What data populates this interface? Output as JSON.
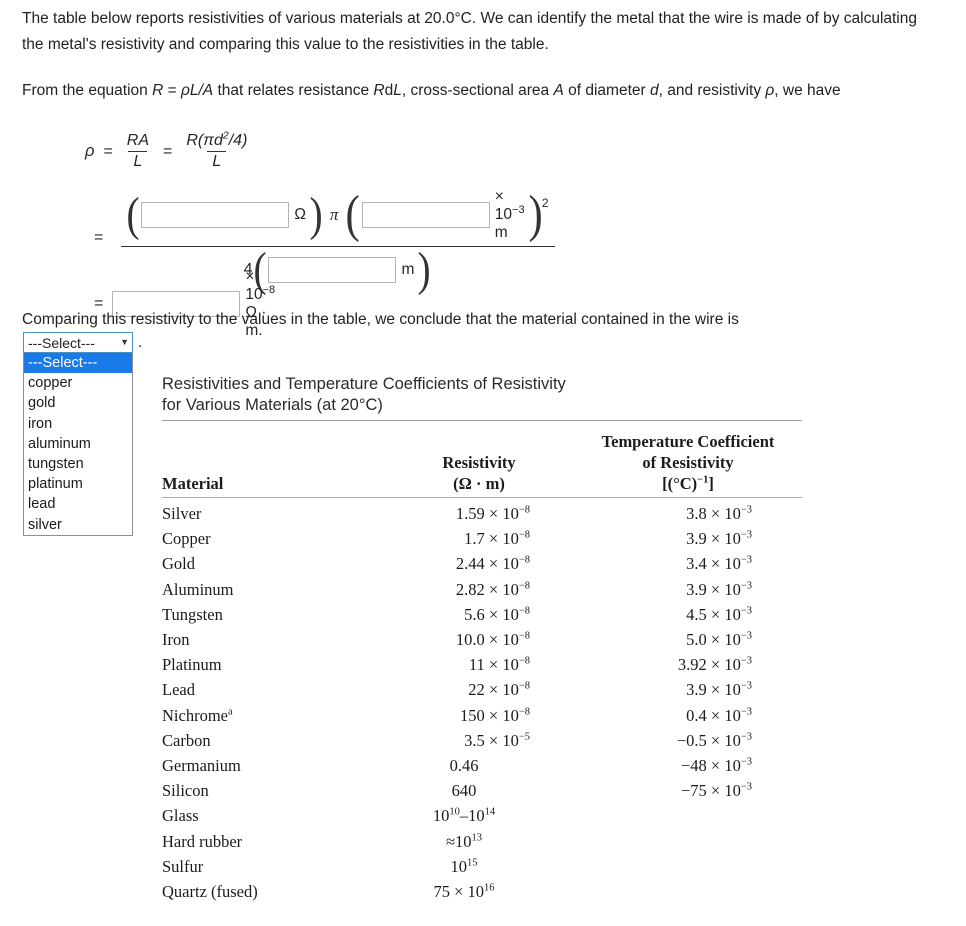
{
  "paragraphs": {
    "p1": "The table below reports resistivities of various materials at 20.0°C. We can identify the metal that the wire is made of by calculating the metal's resistivity and comparing this value to the resistivities in the table.",
    "p2_a": "From the equation ",
    "p2_R": "R",
    "p2_b": " = ",
    "p2_rho": "ρL/A",
    "p2_c": " that relates resistance ",
    "p2_R2": "R",
    "p2_d": "d",
    "p2_L": "L",
    "p2_e": ", cross-sectional area ",
    "p2_A": "A",
    "p2_f": " of diameter ",
    "p2_g": ", and resistivity ",
    "p2_rho2": "ρ",
    "p2_h": ", we have",
    "p3": "Comparing this resistivity to the values in the table, we conclude that the material contained in the wire is"
  },
  "equation": {
    "rho": "ρ",
    "eq1": "=",
    "eq2": "=",
    "eq3": "=",
    "eq4": "=",
    "frac1_num": "RA",
    "frac1_den": "L",
    "frac2_num": "R(πd2/4)",
    "frac2_num_pre": "R(πd",
    "frac2_num_sup": "2",
    "frac2_num_post": "/4)",
    "frac2_den": "L",
    "ohm_unit": "Ω",
    "pi": "π",
    "times": "×",
    "exp_minus3_base": "10",
    "exp_minus3_sup": "−3",
    "meter_unit": "m",
    "squared": "2",
    "denom_four": "4",
    "denom_meter": "m",
    "final_times": "×",
    "final_base": "10",
    "final_sup": "−8",
    "final_unit": "Ω · m.",
    "input_resistance_value": "",
    "input_diameter_value": "",
    "input_length_value": "",
    "input_result_value": ""
  },
  "select": {
    "closed_label": "---Select---",
    "caret": "▼",
    "period": ".",
    "options": [
      "---Select---",
      "copper",
      "gold",
      "iron",
      "aluminum",
      "tungsten",
      "platinum",
      "lead",
      "silver"
    ],
    "highlighted_index": 0,
    "highlight_color": "#1a7ae8"
  },
  "table": {
    "title_line1": "Resistivities and Temperature Coefficients of Resistivity",
    "title_line2": "for Various Materials (at 20°C)",
    "headers": {
      "material": "Material",
      "resistivity_line1": "Resistivity",
      "resistivity_line2": "(Ω · m)",
      "tempcoef_line1": "Temperature Coefficient",
      "tempcoef_line2": "of Resistivity",
      "tempcoef_line3": "[(°C)−1]"
    },
    "rows": [
      {
        "material": "Silver",
        "resistivity": "1.59 × 10−8",
        "tempcoef": "3.8 × 10−3"
      },
      {
        "material": "Copper",
        "resistivity": "1.7 × 10−8",
        "tempcoef": "3.9 × 10−3"
      },
      {
        "material": "Gold",
        "resistivity": "2.44 × 10−8",
        "tempcoef": "3.4 × 10−3"
      },
      {
        "material": "Aluminum",
        "resistivity": "2.82 × 10−8",
        "tempcoef": "3.9 × 10−3"
      },
      {
        "material": "Tungsten",
        "resistivity": "5.6 × 10−8",
        "tempcoef": "4.5 × 10−3"
      },
      {
        "material": "Iron",
        "resistivity": "10.0 × 10−8",
        "tempcoef": "5.0 × 10−3"
      },
      {
        "material": "Platinum",
        "resistivity": "11 × 10−8",
        "tempcoef": "3.92 × 10−3"
      },
      {
        "material": "Lead",
        "resistivity": "22 × 10−8",
        "tempcoef": "3.9 × 10−3"
      },
      {
        "material": "Nichromea",
        "resistivity": "150 × 10−8",
        "tempcoef": "0.4 × 10−3"
      },
      {
        "material": "Carbon",
        "resistivity": "3.5 × 10−5",
        "tempcoef": "−0.5 × 10−3"
      },
      {
        "material": "Germanium",
        "resistivity": "0.46",
        "tempcoef": "−48 × 10−3"
      },
      {
        "material": "Silicon",
        "resistivity": "640",
        "tempcoef": "−75 × 10−3"
      },
      {
        "material": "Glass",
        "resistivity": "1010–1014",
        "tempcoef": ""
      },
      {
        "material": "Hard rubber",
        "resistivity": "≈1013",
        "tempcoef": ""
      },
      {
        "material": "Sulfur",
        "resistivity": "1015",
        "tempcoef": ""
      },
      {
        "material": "Quartz (fused)",
        "resistivity": "75 × 1016",
        "tempcoef": ""
      }
    ]
  }
}
